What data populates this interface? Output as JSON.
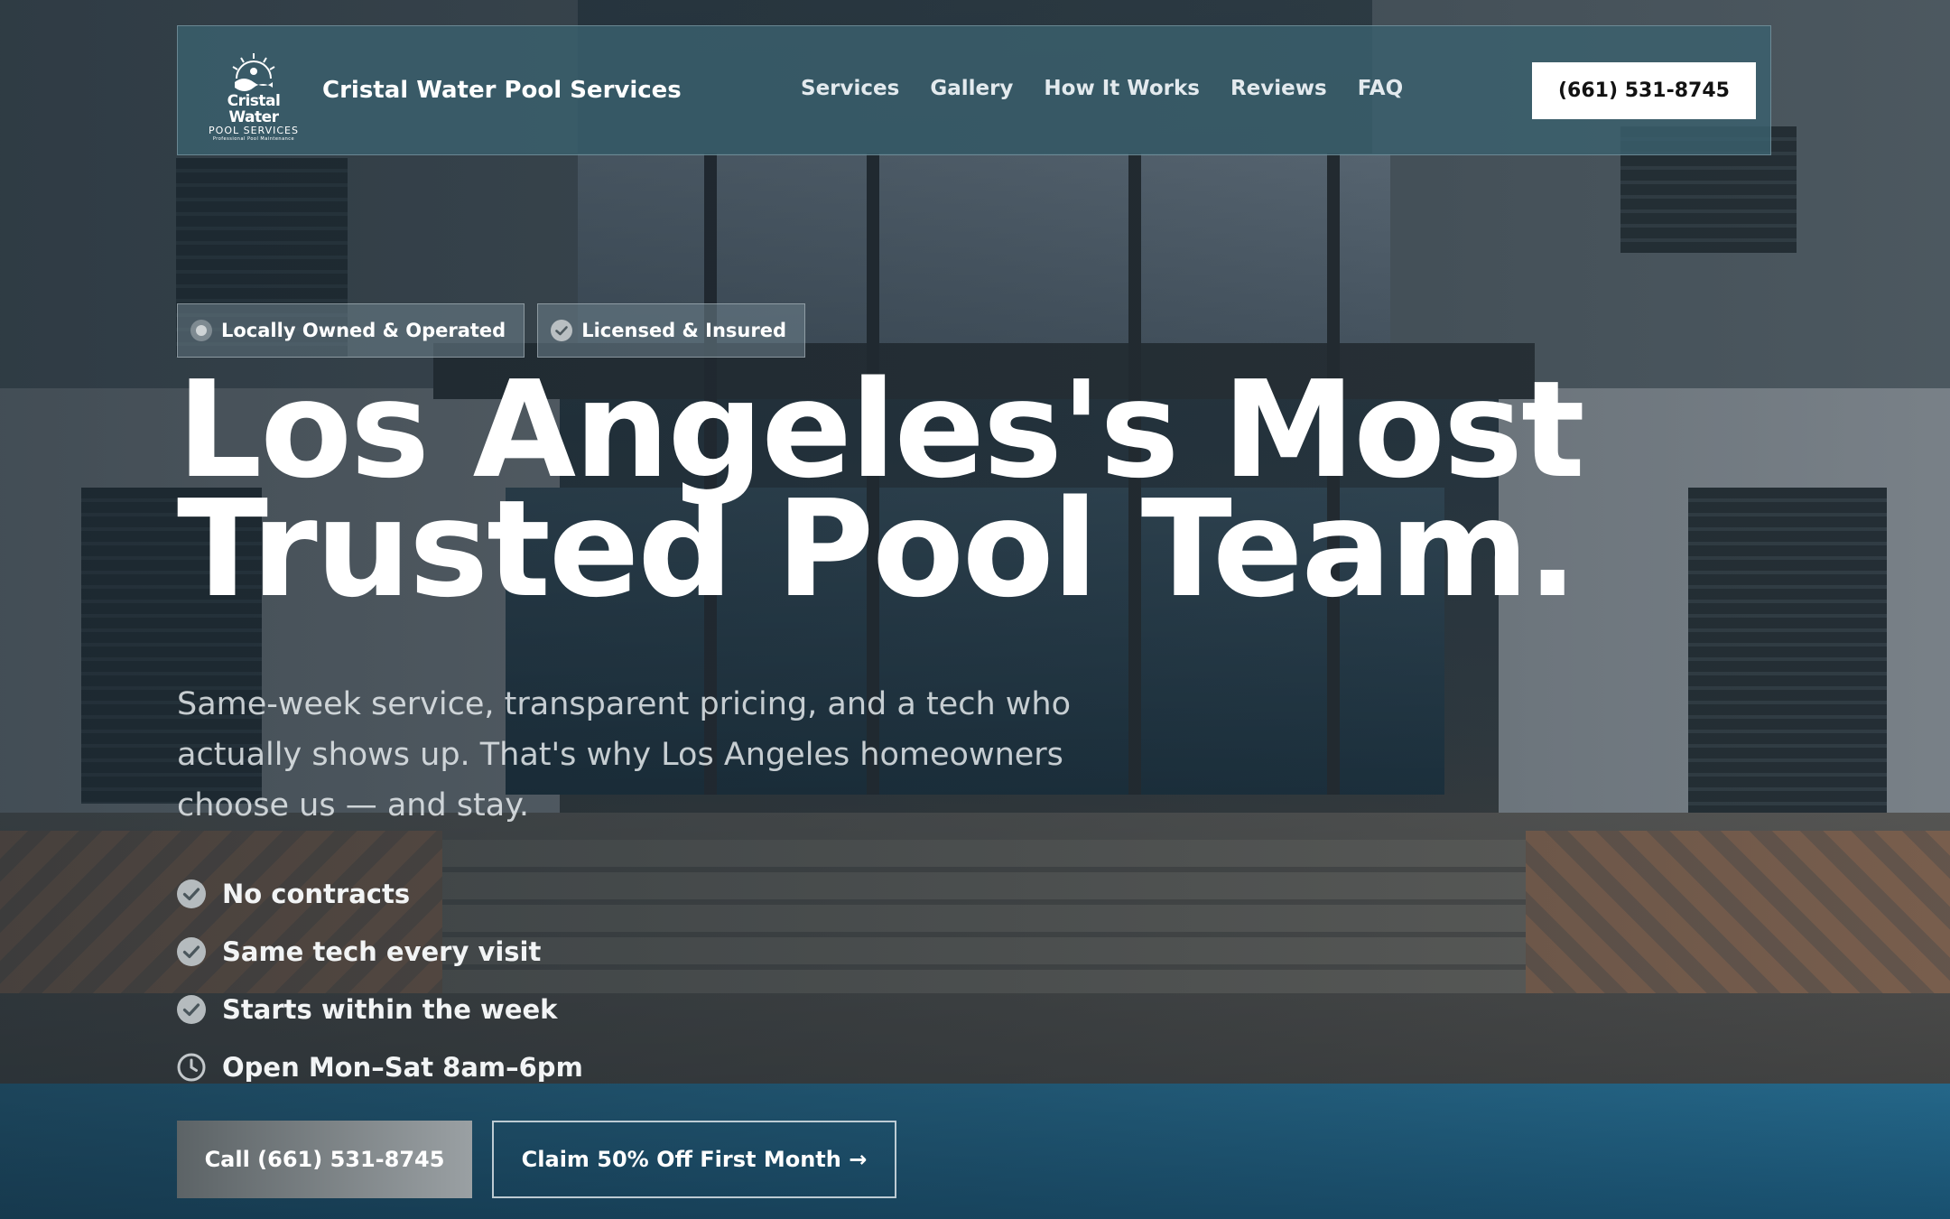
{
  "header": {
    "logo": {
      "line1": "Cristal Water",
      "line2": "POOL SERVICES",
      "line3": "Professional Pool Maintenance"
    },
    "brand_name": "Cristal Water Pool Services",
    "nav": [
      "Services",
      "Gallery",
      "How It Works",
      "Reviews",
      "FAQ"
    ],
    "phone_button": "(661) 531-8745"
  },
  "badges": [
    {
      "icon": "dot-icon",
      "label": "Locally Owned & Operated"
    },
    {
      "icon": "check-circle-icon",
      "label": "Licensed & Insured"
    }
  ],
  "hero": {
    "headline_line1": "Los Angeles's Most",
    "headline_line2": "Trusted Pool Team.",
    "subtext": "Same-week service, transparent pricing, and a tech who actually shows up. That's why Los Angeles homeowners choose us — and stay."
  },
  "features": [
    {
      "icon": "check-circle-icon",
      "label": "No contracts"
    },
    {
      "icon": "check-circle-icon",
      "label": "Same tech every visit"
    },
    {
      "icon": "check-circle-icon",
      "label": "Starts within the week"
    },
    {
      "icon": "clock-icon",
      "label": "Open Mon–Sat 8am–6pm"
    }
  ],
  "cta": {
    "call": "Call (661) 531-8745",
    "claim": "Claim 50% Off First Month →"
  },
  "colors": {
    "header_bg": "#3a606e",
    "button_light": "#ffffff",
    "text_primary": "#ffffff"
  }
}
